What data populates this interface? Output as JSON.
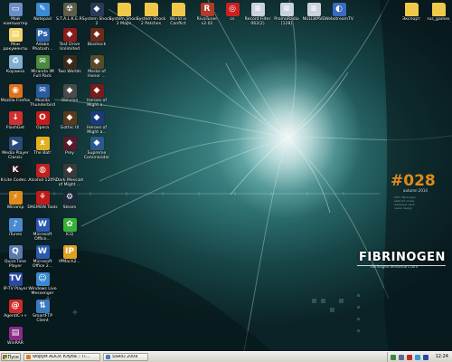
{
  "desktop": {
    "wallpaper": {
      "brand_mark": "#028",
      "brand_mark_sub": "autumn 2014",
      "brand_name": "FIBRINOGEN",
      "brand_tagline": "fibrinogen.deviantart.com",
      "fine_print": "028 / fibrinogen\nabstract series\nwallpaper pack\nvisual  design"
    },
    "icons": [
      {
        "label": "Мой компьютер",
        "icon": "computer-icon",
        "color": "#6a8fc8"
      },
      {
        "label": "Notepad",
        "icon": "notepad-icon",
        "color": "#3a8ad6"
      },
      {
        "label": "S.T.A.L.K.E.R.",
        "icon": "stalker-icon",
        "color": "#5d5d4a"
      },
      {
        "label": "System Shock 2",
        "icon": "game-icon",
        "color": "#2a3a5a"
      },
      {
        "label": "System Shock 2 Maps",
        "icon": "folder-icon",
        "color": "#f0c94a"
      },
      {
        "label": "System Shock 2 Patches",
        "icon": "folder-icon",
        "color": "#f0c94a"
      },
      {
        "label": "World in Conflict",
        "icon": "folder-icon",
        "color": "#f0c94a"
      },
      {
        "label": "RivaTuner v2.02",
        "icon": "rivatuner-icon",
        "color": "#b23a2a"
      },
      {
        "label": "cs",
        "icon": "cs-icon",
        "color": "#cc2020"
      },
      {
        "label": "Record Filter 062(2)",
        "icon": "file-icon",
        "color": "#c9d3dc"
      },
      {
        "label": "PromoRadio [128]",
        "icon": "file-icon",
        "color": "#c9d3dc"
      },
      {
        "label": "NULLWAVE",
        "icon": "file-icon",
        "color": "#c9d3dc"
      },
      {
        "label": "WebstreamTV",
        "icon": "webstream-icon",
        "color": "#3a6ac0"
      },
      {
        "label": "Экспорт",
        "icon": "folder-icon",
        "color": "#f0c94a"
      },
      {
        "label": "rus_games",
        "icon": "folder-icon",
        "color": "#f0c94a"
      },
      {
        "label": "Мои документы",
        "icon": "my-documents-icon",
        "color": "#f2d46a"
      },
      {
        "label": "Adobe Photosh...",
        "icon": "photoshop-icon",
        "color": "#2c5fa8"
      },
      {
        "label": "Test Drive Unlimited",
        "icon": "game-icon",
        "color": "#8a1c1c"
      },
      {
        "label": "Bioshock",
        "icon": "game-icon",
        "color": "#6b2a1a"
      },
      {
        "label": "Корзина",
        "icon": "recycle-bin-icon",
        "color": "#7fb0d0"
      },
      {
        "label": "Miranda IM Full Pack",
        "icon": "miranda-icon",
        "color": "#4a8a3a"
      },
      {
        "label": "Two Worlds",
        "icon": "game-icon",
        "color": "#3a2a1a"
      },
      {
        "label": "Medal of Honor ...",
        "icon": "game-icon",
        "color": "#5a4a2a"
      },
      {
        "label": "Mozilla Firefox",
        "icon": "firefox-icon",
        "color": "#e0701a"
      },
      {
        "label": "Mozilla Thunderbird",
        "icon": "thunderbird-icon",
        "color": "#2a5aa0"
      },
      {
        "label": "Oblivion",
        "icon": "game-icon",
        "color": "#4a4a4a"
      },
      {
        "label": "Heroes of Might a...",
        "icon": "game-icon",
        "color": "#7a1a1a"
      },
      {
        "label": "FlashGet",
        "icon": "flashget-icon",
        "color": "#d03030"
      },
      {
        "label": "Opera",
        "icon": "opera-icon",
        "color": "#c81a1a"
      },
      {
        "label": "Gothic III",
        "icon": "game-icon",
        "color": "#5a3a1a"
      },
      {
        "label": "Heroes of Might a...",
        "icon": "game-icon",
        "color": "#1a3a7a"
      },
      {
        "label": "Media Player Classic",
        "icon": "media-player-icon",
        "color": "#2a4a7a"
      },
      {
        "label": "The Bat!",
        "icon": "thebat-icon",
        "color": "#e0b020"
      },
      {
        "label": "Prey",
        "icon": "game-icon",
        "color": "#5a1a2a"
      },
      {
        "label": "Supreme Commander",
        "icon": "game-icon",
        "color": "#2a5a8a"
      },
      {
        "label": "K-Lite Codec...",
        "icon": "klite-icon",
        "color": "#1a1a1a"
      },
      {
        "label": "Alcohol 120%",
        "icon": "alcohol-icon",
        "color": "#c02020"
      },
      {
        "label": "Dark Messiah of Might ...",
        "icon": "game-icon",
        "color": "#3a3a3a"
      },
      {
        "label": "Winamp",
        "icon": "winamp-icon",
        "color": "#e08a1a"
      },
      {
        "label": "DAEMON Tools",
        "icon": "daemon-tools-icon",
        "color": "#c01a1a"
      },
      {
        "label": "Steam",
        "icon": "steam-icon",
        "color": "#1a2a3a"
      },
      {
        "label": "iTunes",
        "icon": "itunes-icon",
        "color": "#4a8ad0"
      },
      {
        "label": "Microsoft Office...",
        "icon": "office-icon",
        "color": "#2a5ab0"
      },
      {
        "label": "ICQ",
        "icon": "icq-icon",
        "color": "#3ab03a"
      },
      {
        "label": "QuickTime Player",
        "icon": "quicktime-icon",
        "color": "#5a7ab0"
      },
      {
        "label": "Microsoft Office 2...",
        "icon": "office-icon",
        "color": "#2a5ab0"
      },
      {
        "label": "IPMach2...",
        "icon": "ip-icon",
        "color": "#e0a020"
      },
      {
        "label": "IP-TV Player",
        "icon": "iptv-icon",
        "color": "#2a4aa0"
      },
      {
        "label": "Windows Live Messenger",
        "icon": "messenger-icon",
        "color": "#3a8ad0"
      },
      {
        "label": "AgentIC++",
        "icon": "agent-icon",
        "color": "#d02a2a"
      },
      {
        "label": "SmartFTP Client",
        "icon": "smartftp-icon",
        "color": "#3a7ac0"
      },
      {
        "label": "WinRAR",
        "icon": "winrar-icon",
        "color": "#8a2a8a"
      }
    ]
  },
  "taskbar": {
    "start_label": "Пуск",
    "tasks": [
      {
        "label": "Форум ADDX Клуба :: П...",
        "icon": "browser-icon"
      },
      {
        "label": "SSRIO 2009",
        "icon": "window-icon"
      }
    ],
    "tray": {
      "clock": "12:24",
      "icons": [
        "network-icon",
        "volume-icon",
        "antivirus-icon",
        "messenger-icon",
        "language-icon"
      ]
    }
  },
  "colors": {
    "taskbar_bg": "#dedbd1",
    "wallpaper_base": "#0b2326",
    "brand_orange": "#e08a1a"
  }
}
